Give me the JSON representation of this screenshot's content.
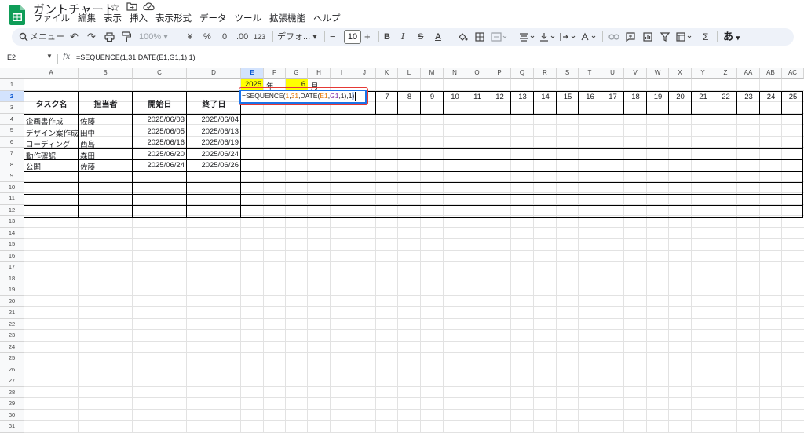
{
  "window": {
    "title": "ガントチャート",
    "menu": [
      "ファイル",
      "編集",
      "表示",
      "挿入",
      "表示形式",
      "データ",
      "ツール",
      "拡張機能",
      "ヘルプ"
    ]
  },
  "toolbar": {
    "search_label": "メニュー",
    "zoom": "100%",
    "currency": "¥",
    "percent": "%",
    "dec_decrease": ".0",
    "dec_increase": ".00",
    "number_format": "123",
    "font": "デフォ...",
    "font_size": "10",
    "minus": "−",
    "plus": "+",
    "bold": "B",
    "italic": "I",
    "strikethrough": "S",
    "text_color": "A",
    "sigma": "Σ",
    "input_mode": "あ"
  },
  "formula_bar": {
    "cell_ref": "E2",
    "formula": "=SEQUENCE(1,31,DATE(E1,G1,1),1)"
  },
  "grid": {
    "columns": [
      "A",
      "B",
      "C",
      "D",
      "E",
      "F",
      "G",
      "H",
      "I",
      "J",
      "K",
      "L",
      "M",
      "N",
      "O",
      "P",
      "Q",
      "R",
      "S",
      "T",
      "U",
      "V",
      "W",
      "X",
      "Y",
      "Z",
      "AA",
      "AB",
      "AC"
    ],
    "active_column": "E",
    "rows": [
      "1",
      "2",
      "3",
      "4",
      "5",
      "6",
      "7",
      "8",
      "9",
      "10",
      "11",
      "12",
      "13",
      "14",
      "15",
      "16",
      "17",
      "18",
      "19",
      "20",
      "21",
      "22",
      "23",
      "24",
      "25",
      "26",
      "27",
      "28",
      "29",
      "30",
      "31"
    ],
    "active_row": "2",
    "year_value": "2025",
    "year_label": "年",
    "month_value": "6",
    "month_label": "月",
    "header": {
      "task": "タスク名",
      "assignee": "担当者",
      "start": "開始日",
      "end": "終了日"
    },
    "tasks": [
      {
        "name": "企画書作成",
        "assignee": "佐藤",
        "start": "2025/06/03",
        "end": "2025/06/04"
      },
      {
        "name": "デザイン案作成",
        "assignee": "田中",
        "start": "2025/06/05",
        "end": "2025/06/13"
      },
      {
        "name": "コーディング",
        "assignee": "西島",
        "start": "2025/06/16",
        "end": "2025/06/19"
      },
      {
        "name": "動作確認",
        "assignee": "森田",
        "start": "2025/06/20",
        "end": "2025/06/24"
      },
      {
        "name": "公開",
        "assignee": "佐藤",
        "start": "2025/06/24",
        "end": "2025/06/26"
      }
    ],
    "day_numbers": [
      "7",
      "8",
      "9",
      "10",
      "11",
      "12",
      "13",
      "14",
      "15",
      "16",
      "17",
      "18",
      "19",
      "20",
      "21",
      "22",
      "23",
      "24",
      "25"
    ],
    "editor": {
      "prefix": "=SEQUENCE(",
      "arg1": "1",
      "sep1": ",",
      "arg2": "31",
      "mid": ",DATE(",
      "ref1": "E1",
      "sep2": ",",
      "ref2": "G1",
      "tail": ",1),1",
      "close": ")"
    }
  }
}
